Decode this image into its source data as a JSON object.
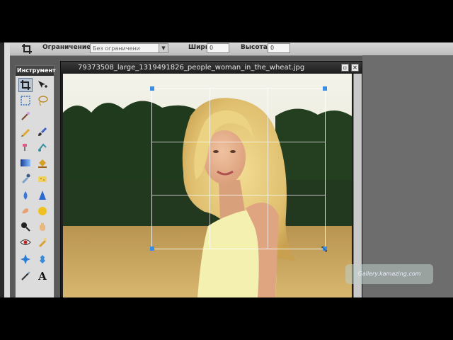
{
  "options_bar": {
    "constraint_label": "Ограничение:",
    "constraint_value": "Без ограничени",
    "width_label": "Ширина:",
    "width_value": "0",
    "height_label": "Высота:",
    "height_value": "0"
  },
  "tools_panel": {
    "title": "Инструмент",
    "tools": [
      "crop-icon",
      "move-icon",
      "marquee-icon",
      "lasso-icon",
      "wand-icon",
      "pencil-icon",
      "brush-icon",
      "clone-icon",
      "eraser-icon",
      "replace-color-icon",
      "gradient-icon",
      "fill-icon",
      "color-picker-icon",
      "sponge-icon",
      "blur-drop-icon",
      "sharpen-icon",
      "smudge-icon",
      "dodge-icon",
      "burn-icon",
      "zoom-icon",
      "red-eye-icon",
      "hand-icon",
      "spot-heal-icon",
      "bloat-icon",
      "pen-icon",
      "text-icon"
    ]
  },
  "image_window": {
    "filename": "79373508_large_1319491826_people_woman_in_the_wheat.jpg"
  },
  "watermark": {
    "text": "Gallery.kamazing.com"
  },
  "colors": {
    "accent": "#3a8ee6",
    "titlebar": "#2d2d2d",
    "panel": "#dcdcdc"
  }
}
